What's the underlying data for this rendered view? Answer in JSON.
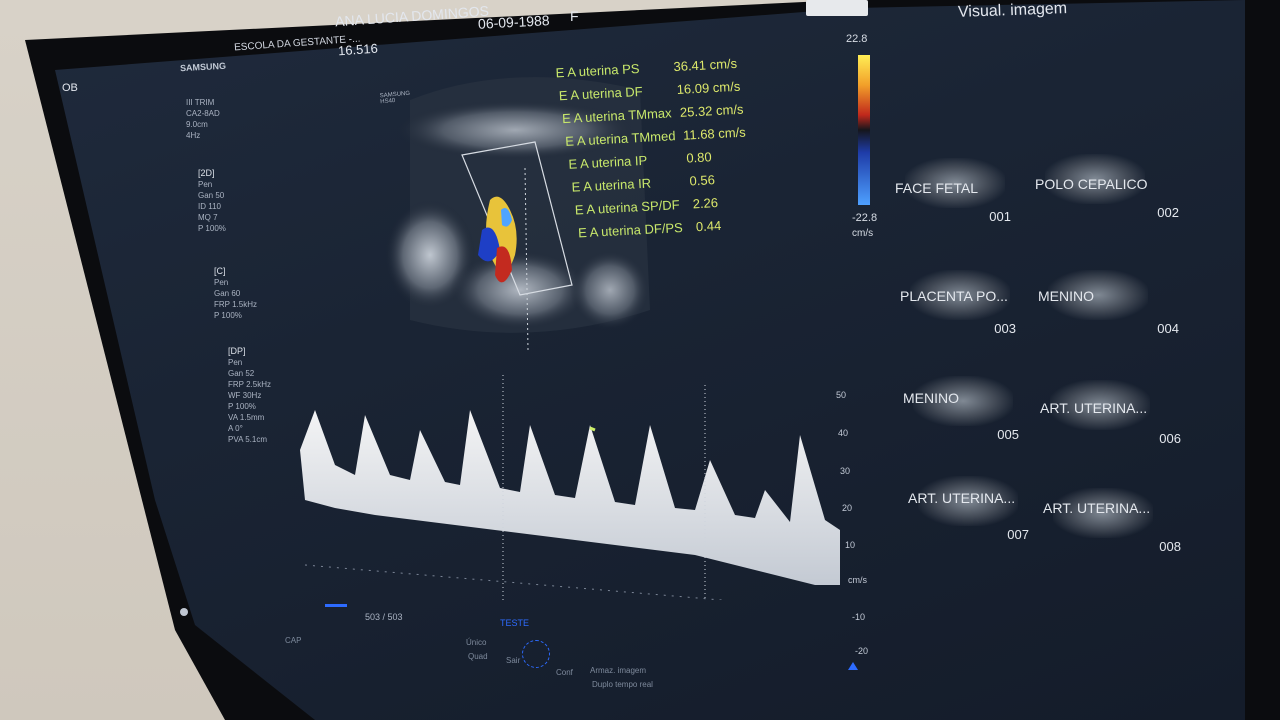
{
  "header": {
    "brand": "SAMSUNG",
    "institution": "ESCOLA DA GESTANTE -...",
    "patient_name": "ANA LUCIA DOMINGOS",
    "patient_id": "16.516",
    "birth_date": "06-09-1988",
    "sex": "F",
    "mode": "OB",
    "right_title": "Visual. imagem"
  },
  "probe_info": {
    "lines": [
      "III TRIM",
      "CA2-8AD",
      "9.0cm",
      "4Hz"
    ]
  },
  "params_2d": {
    "title": "[2D]",
    "lines": [
      "Pen",
      "Gan   50",
      "ID    110",
      "MQ    7",
      "P     100%"
    ]
  },
  "params_c": {
    "title": "[C]",
    "lines": [
      "Pen",
      "Gan   60",
      "FRP   1.5kHz",
      "P     100%"
    ]
  },
  "params_dp": {
    "title": "[DP]",
    "lines": [
      "Pen",
      "Gan   52",
      "FRP   2.5kHz",
      "WF    30Hz",
      "P     100%",
      "VA    1.5mm",
      "A     0°",
      "PVA   5.1cm"
    ]
  },
  "probe_tag": "SAMSUNG HS40",
  "measurements": [
    {
      "label": "E A uterina PS",
      "value": "36.41 cm/s"
    },
    {
      "label": "E A uterina DF",
      "value": "16.09 cm/s"
    },
    {
      "label": "E A uterina TMmax",
      "value": "25.32 cm/s"
    },
    {
      "label": "E A uterina TMmed",
      "value": "11.68 cm/s"
    },
    {
      "label": "E A uterina IP",
      "value": "0.80"
    },
    {
      "label": "E A uterina IR",
      "value": "0.56"
    },
    {
      "label": "E A uterina SP/DF",
      "value": "2.26"
    },
    {
      "label": "E A uterina DF/PS",
      "value": "0.44"
    }
  ],
  "color_scale": {
    "top": "22.8",
    "bottom": "-22.8",
    "unit": "cm/s"
  },
  "doppler_axis": {
    "ticks": [
      "50",
      "40",
      "30",
      "20",
      "10",
      "cm/s",
      "-10",
      "-20"
    ]
  },
  "thumbnails": [
    {
      "label": "FACE FETAL",
      "num": "001"
    },
    {
      "label": "POLO CEPALICO",
      "num": "002"
    },
    {
      "label": "PLACENTA PO...",
      "num": "003"
    },
    {
      "label": "MENINO",
      "num": "004"
    },
    {
      "label": "MENINO",
      "num": "005"
    },
    {
      "label": "ART. UTERINA...",
      "num": "006"
    },
    {
      "label": "ART. UTERINA...",
      "num": "007"
    },
    {
      "label": "ART. UTERINA...",
      "num": "008"
    }
  ],
  "bottom": {
    "frame_counter": "503 / 503",
    "cap": "CAP",
    "teste": "TESTE",
    "unico": "Único",
    "quad": "Quad",
    "sair": "Sair",
    "conf": "Conf",
    "armaz": "Armaz. imagem",
    "duplo": "Duplo tempo real"
  },
  "colors": {
    "measurement": "#c8e86b",
    "accent_blue": "#2d6bff",
    "background": "#1a2434"
  }
}
